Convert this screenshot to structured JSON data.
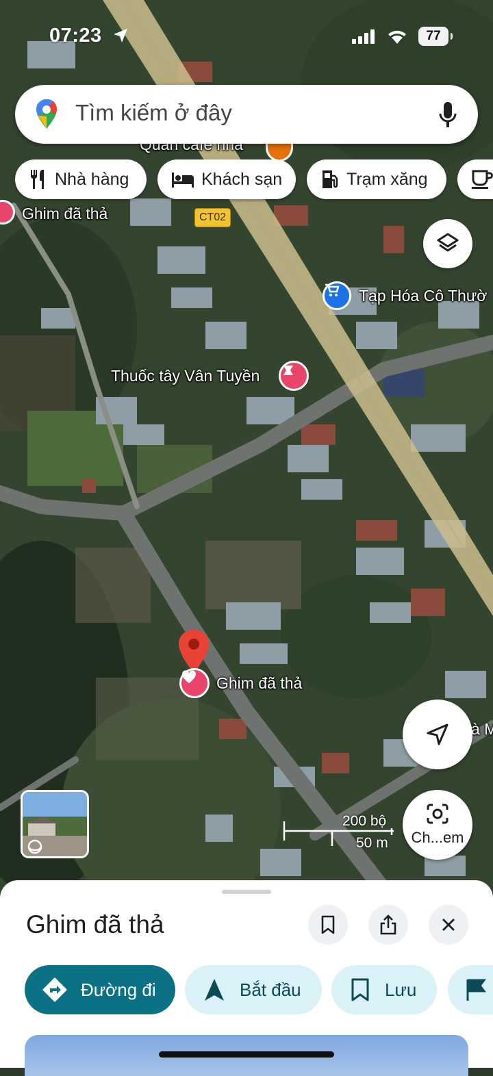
{
  "status_bar": {
    "time": "07:23",
    "battery": "77"
  },
  "search": {
    "placeholder": "Tìm kiếm ở đây"
  },
  "chips": [
    {
      "label": "Nhà hàng",
      "icon": "restaurant-icon"
    },
    {
      "label": "Khách sạn",
      "icon": "hotel-icon"
    },
    {
      "label": "Trạm xăng",
      "icon": "gas-station-icon"
    },
    {
      "label": "",
      "icon": "coffee-icon"
    }
  ],
  "map": {
    "labels": {
      "cafe": "Quán cafe nhà",
      "pin_top": "Ghim đã thả",
      "road_code": "CT02",
      "store": "Tạp Hóa Cô Thườ",
      "pharmacy": "Thuốc tây Vân Tuyền",
      "pin_main": "Ghim đã thả",
      "edge": "à M"
    },
    "scale": {
      "imperial": "200 bộ",
      "metric": "50 m"
    },
    "camera_label": "Ch...em"
  },
  "sheet": {
    "title": "Ghim đã thả",
    "actions": {
      "directions": "Đường đi",
      "start": "Bắt đầu",
      "save": "Lưu"
    }
  },
  "colors": {
    "accent": "#0b7285",
    "light_action": "#d9f1f7",
    "pin_red": "#ea4335",
    "pink_pin": "#e9446a"
  }
}
